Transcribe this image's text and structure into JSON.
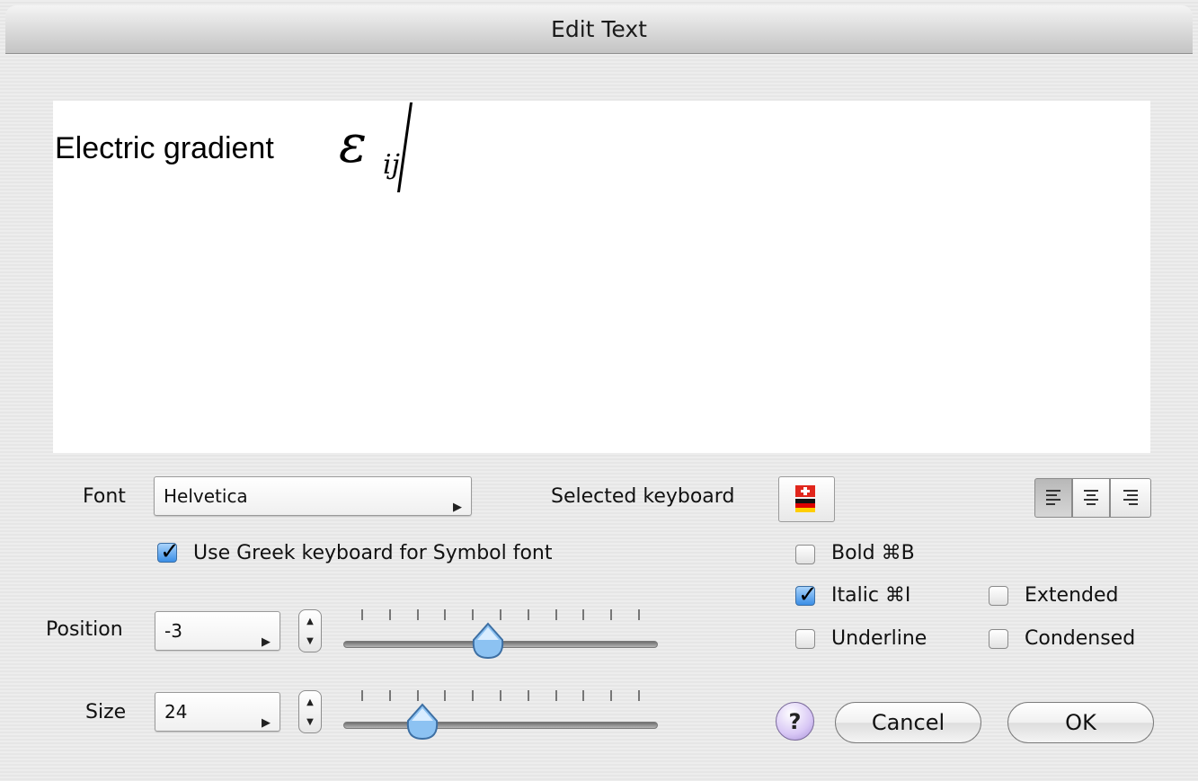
{
  "window": {
    "title": "Edit Text"
  },
  "editor": {
    "text": "Electric gradient",
    "symbol": "ε",
    "subscript": "ij"
  },
  "font": {
    "label": "Font",
    "value": "Helvetica"
  },
  "keyboard": {
    "label": "Selected keyboard",
    "flag": "swiss-german-flag-icon"
  },
  "greek": {
    "label": "Use Greek keyboard for Symbol font",
    "checked": true
  },
  "position": {
    "label": "Position",
    "value": "-3",
    "slider_fraction": 0.46
  },
  "size": {
    "label": "Size",
    "value": "24",
    "slider_fraction": 0.25
  },
  "styles": {
    "bold": {
      "label": "Bold ⌘B",
      "checked": false
    },
    "italic": {
      "label": "Italic ⌘I",
      "checked": true
    },
    "underline": {
      "label": "Underline",
      "checked": false
    },
    "extended": {
      "label": "Extended",
      "checked": false
    },
    "condensed": {
      "label": "Condensed",
      "checked": false
    }
  },
  "alignment": {
    "selected": "left",
    "options": [
      "left",
      "center",
      "right"
    ]
  },
  "buttons": {
    "help": "?",
    "cancel": "Cancel",
    "ok": "OK"
  },
  "colors": {
    "check_blue": "#3b8ee6",
    "help_purple": "#d8c7f5"
  }
}
